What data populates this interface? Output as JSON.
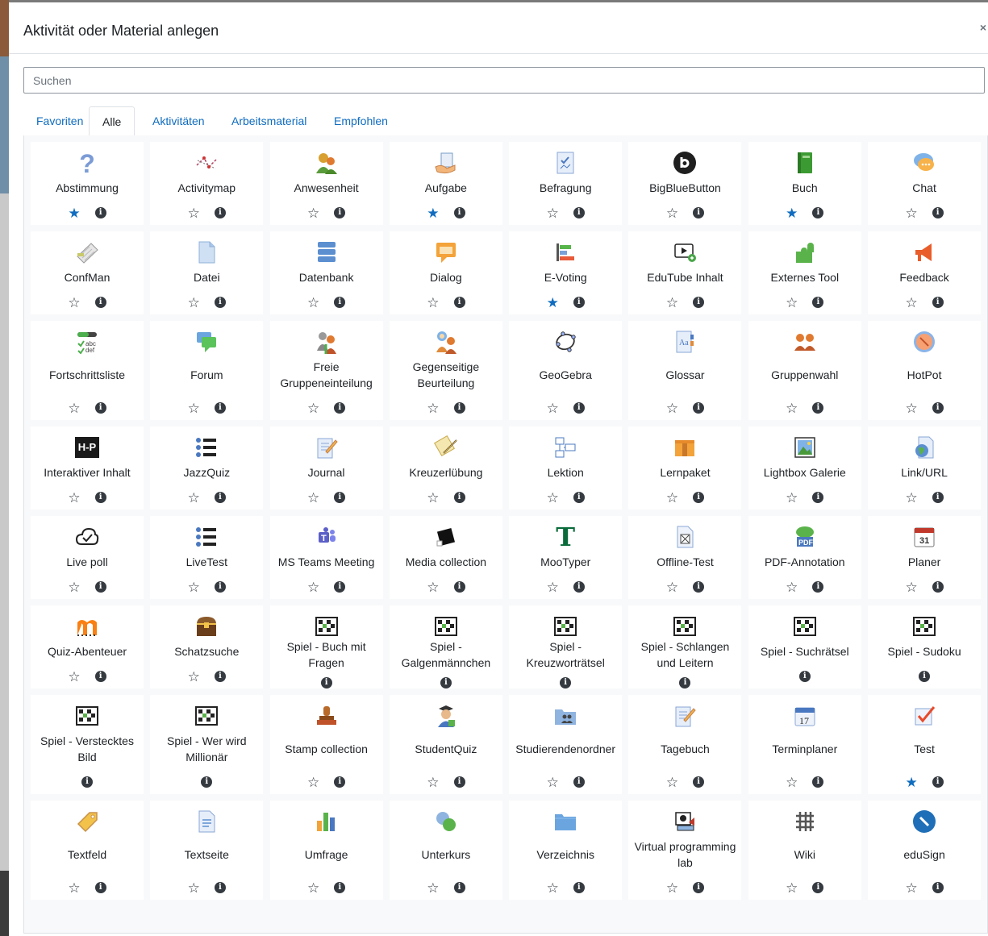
{
  "modal": {
    "title": "Aktivität oder Material anlegen",
    "close": "×"
  },
  "search": {
    "placeholder": "Suchen"
  },
  "tabs": [
    {
      "label": "Favoriten"
    },
    {
      "label": "Alle"
    },
    {
      "label": "Aktivitäten"
    },
    {
      "label": "Arbeitsmaterial"
    },
    {
      "label": "Empfohlen"
    }
  ],
  "ui": {
    "star_empty": "☆",
    "star_filled": "★",
    "info_glyph": "i"
  },
  "items": [
    {
      "label": "Abstimmung",
      "icon": "question-icon",
      "favorite": true,
      "star": true
    },
    {
      "label": "Activitymap",
      "icon": "activitymap-icon",
      "favorite": false,
      "star": true
    },
    {
      "label": "Anwesenheit",
      "icon": "attendance-icon",
      "favorite": false,
      "star": true
    },
    {
      "label": "Aufgabe",
      "icon": "assignment-icon",
      "favorite": true,
      "star": true
    },
    {
      "label": "Befragung",
      "icon": "feedback-chart-icon",
      "favorite": false,
      "star": true
    },
    {
      "label": "BigBlueButton",
      "icon": "bigbluebutton-icon",
      "favorite": false,
      "star": true
    },
    {
      "label": "Buch",
      "icon": "book-icon",
      "favorite": true,
      "star": true
    },
    {
      "label": "Chat",
      "icon": "chat-bubble-icon",
      "favorite": false,
      "star": true
    },
    {
      "label": "ConfMan",
      "icon": "confman-icon",
      "favorite": false,
      "star": true
    },
    {
      "label": "Datei",
      "icon": "file-icon",
      "favorite": false,
      "star": true
    },
    {
      "label": "Datenbank",
      "icon": "database-icon",
      "favorite": false,
      "star": true
    },
    {
      "label": "Dialog",
      "icon": "dialog-icon",
      "favorite": false,
      "star": true
    },
    {
      "label": "E-Voting",
      "icon": "evoting-icon",
      "favorite": true,
      "star": true
    },
    {
      "label": "EduTube Inhalt",
      "icon": "edutube-icon",
      "favorite": false,
      "star": true
    },
    {
      "label": "Externes Tool",
      "icon": "puzzle-icon",
      "favorite": false,
      "star": true
    },
    {
      "label": "Feedback",
      "icon": "megaphone-icon",
      "favorite": false,
      "star": true
    },
    {
      "label": "Fortschrittsliste",
      "icon": "checklist-icon",
      "favorite": false,
      "star": true
    },
    {
      "label": "Forum",
      "icon": "forum-icon",
      "favorite": false,
      "star": true
    },
    {
      "label": "Freie Gruppeneinteilung",
      "icon": "group-choice-icon",
      "favorite": false,
      "star": true
    },
    {
      "label": "Gegenseitige Beurteilung",
      "icon": "workshop-icon",
      "favorite": false,
      "star": true
    },
    {
      "label": "GeoGebra",
      "icon": "geogebra-icon",
      "favorite": false,
      "star": true
    },
    {
      "label": "Glossar",
      "icon": "glossary-icon",
      "favorite": false,
      "star": true
    },
    {
      "label": "Gruppenwahl",
      "icon": "groups-icon",
      "favorite": false,
      "star": true
    },
    {
      "label": "HotPot",
      "icon": "hotpot-icon",
      "favorite": false,
      "star": true
    },
    {
      "label": "Interaktiver Inhalt",
      "icon": "h5p-icon",
      "favorite": false,
      "star": true
    },
    {
      "label": "JazzQuiz",
      "icon": "list-icon",
      "favorite": false,
      "star": true
    },
    {
      "label": "Journal",
      "icon": "journal-icon",
      "favorite": false,
      "star": true
    },
    {
      "label": "Kreuzerlübung",
      "icon": "crossword-pencil-icon",
      "favorite": false,
      "star": true
    },
    {
      "label": "Lektion",
      "icon": "lesson-icon",
      "favorite": false,
      "star": true
    },
    {
      "label": "Lernpaket",
      "icon": "package-icon",
      "favorite": false,
      "star": true
    },
    {
      "label": "Lightbox Galerie",
      "icon": "gallery-icon",
      "favorite": false,
      "star": true
    },
    {
      "label": "Link/URL",
      "icon": "url-globe-icon",
      "favorite": false,
      "star": true
    },
    {
      "label": "Live poll",
      "icon": "cloud-check-icon",
      "favorite": false,
      "star": true
    },
    {
      "label": "LiveTest",
      "icon": "list-icon",
      "favorite": false,
      "star": true
    },
    {
      "label": "MS Teams Meeting",
      "icon": "teams-icon",
      "favorite": false,
      "star": true
    },
    {
      "label": "Media collection",
      "icon": "media-icon",
      "favorite": false,
      "star": true
    },
    {
      "label": "MooTyper",
      "icon": "mootyper-icon",
      "favorite": false,
      "star": true
    },
    {
      "label": "Offline-Test",
      "icon": "offline-quiz-icon",
      "favorite": false,
      "star": true
    },
    {
      "label": "PDF-Annotation",
      "icon": "pdf-icon",
      "favorite": false,
      "star": true
    },
    {
      "label": "Planer",
      "icon": "calendar-icon",
      "favorite": false,
      "star": true
    },
    {
      "label": "Quiz-Abenteuer",
      "icon": "moodle-m-icon",
      "favorite": false,
      "star": true
    },
    {
      "label": "Schatzsuche",
      "icon": "treasure-chest-icon",
      "favorite": false,
      "star": true
    },
    {
      "label": "Spiel - Buch mit Fragen",
      "icon": "game-board-icon",
      "favorite": false,
      "star": false
    },
    {
      "label": "Spiel - Galgenmännchen",
      "icon": "game-board-icon",
      "favorite": false,
      "star": false
    },
    {
      "label": "Spiel - Kreuzworträtsel",
      "icon": "game-board-icon",
      "favorite": false,
      "star": false
    },
    {
      "label": "Spiel - Schlangen und Leitern",
      "icon": "game-board-icon",
      "favorite": false,
      "star": false
    },
    {
      "label": "Spiel - Suchrätsel",
      "icon": "game-board-icon",
      "favorite": false,
      "star": false
    },
    {
      "label": "Spiel - Sudoku",
      "icon": "game-board-icon",
      "favorite": false,
      "star": false
    },
    {
      "label": "Spiel - Verstecktes Bild",
      "icon": "game-board-icon",
      "favorite": false,
      "star": false
    },
    {
      "label": "Spiel - Wer wird Millionär",
      "icon": "game-board-icon",
      "favorite": false,
      "star": false
    },
    {
      "label": "Stamp collection",
      "icon": "stamp-icon",
      "favorite": false,
      "star": true
    },
    {
      "label": "StudentQuiz",
      "icon": "student-icon",
      "favorite": false,
      "star": true
    },
    {
      "label": "Studierendenordner",
      "icon": "folder-users-icon",
      "favorite": false,
      "star": true
    },
    {
      "label": "Tagebuch",
      "icon": "journal-icon",
      "favorite": false,
      "star": true
    },
    {
      "label": "Terminplaner",
      "icon": "calendar-17-icon",
      "favorite": false,
      "star": true
    },
    {
      "label": "Test",
      "icon": "quiz-check-icon",
      "favorite": true,
      "star": true
    },
    {
      "label": "Textfeld",
      "icon": "label-tag-icon",
      "favorite": false,
      "star": true
    },
    {
      "label": "Textseite",
      "icon": "page-icon",
      "favorite": false,
      "star": true
    },
    {
      "label": "Umfrage",
      "icon": "bar-chart-icon",
      "favorite": false,
      "star": true
    },
    {
      "label": "Unterkurs",
      "icon": "subcourse-icon",
      "favorite": false,
      "star": true
    },
    {
      "label": "Verzeichnis",
      "icon": "folder-icon",
      "favorite": false,
      "star": true
    },
    {
      "label": "Virtual programming lab",
      "icon": "vpl-icon",
      "favorite": false,
      "star": true
    },
    {
      "label": "Wiki",
      "icon": "wiki-icon",
      "favorite": false,
      "star": true
    },
    {
      "label": "eduSign",
      "icon": "edusign-icon",
      "favorite": false,
      "star": true
    }
  ]
}
